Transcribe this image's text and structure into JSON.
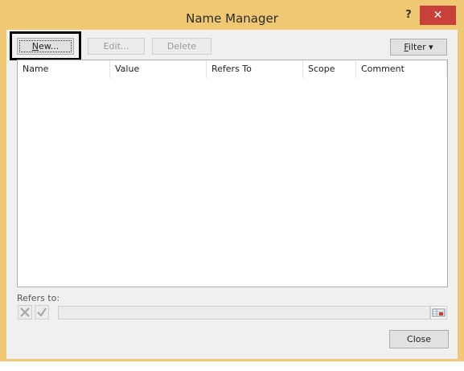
{
  "window": {
    "title": "Name Manager",
    "help_glyph": "?",
    "close_glyph": "✕"
  },
  "toolbar": {
    "new_label_u": "N",
    "new_label_rest": "ew...",
    "edit_label": "Edit...",
    "delete_label": "Delete",
    "filter_label_u": "F",
    "filter_label_rest": "ilter",
    "filter_arrow": "▾"
  },
  "table": {
    "columns": [
      "Name",
      "Value",
      "Refers To",
      "Scope",
      "Comment"
    ],
    "rows": []
  },
  "refers_to": {
    "label": "Refers to:",
    "value": ""
  },
  "footer": {
    "close_label": "Close"
  },
  "icons": {
    "cancel": "cancel-x-icon",
    "confirm": "checkmark-icon",
    "range": "range-select-icon"
  }
}
